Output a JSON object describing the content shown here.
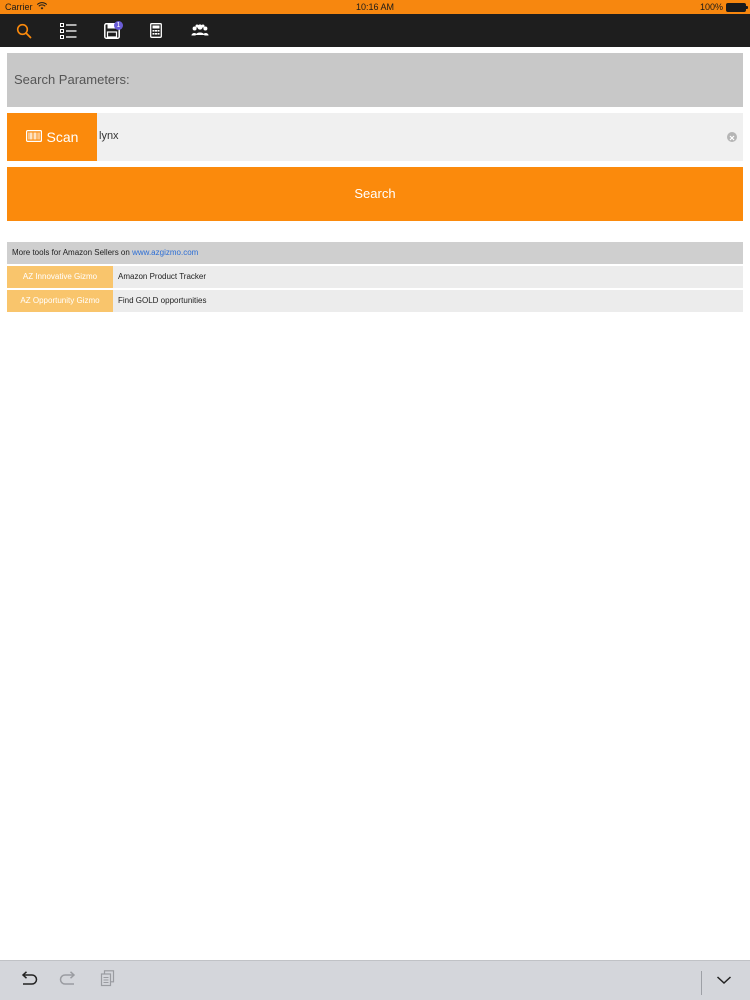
{
  "status": {
    "carrier": "Carrier",
    "time": "10:16 AM",
    "battery": "100%"
  },
  "toolbar": {
    "items": [
      {
        "icon": "search-icon",
        "active": true
      },
      {
        "icon": "list-icon"
      },
      {
        "icon": "save-icon",
        "badge": "1"
      },
      {
        "icon": "calculator-icon"
      },
      {
        "icon": "group-icon"
      }
    ]
  },
  "search": {
    "header": "Search Parameters:",
    "scan_label": "Scan",
    "query": "lynx",
    "button_label": "Search"
  },
  "tools": {
    "intro": "More tools for Amazon Sellers on ",
    "link": "www.azgizmo.com",
    "rows": [
      {
        "name": "AZ Innovative Gizmo",
        "desc": "Amazon Product Tracker"
      },
      {
        "name": "AZ Opportunity Gizmo",
        "desc": "Find GOLD opportunities"
      }
    ]
  },
  "colors": {
    "accent": "#fb8a0c",
    "status_bar": "#f7870f",
    "toolbar_bg": "#1e1e1e",
    "tool_name_bg": "#f9c56c",
    "link": "#2c6ed5"
  }
}
